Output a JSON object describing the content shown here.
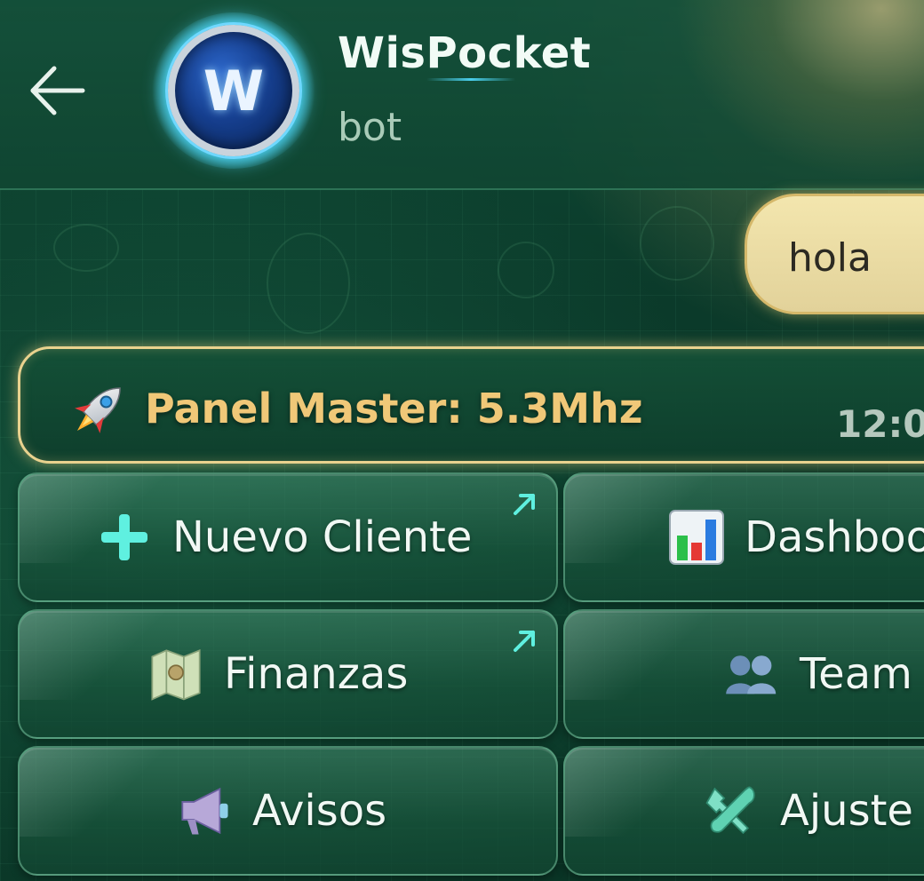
{
  "header": {
    "back_label": "Back",
    "avatar_letter": "W",
    "title": "WisPocket",
    "subtitle": "bot"
  },
  "messages": {
    "user": {
      "text": "hola"
    },
    "bot": {
      "icon": "rocket-icon",
      "text": "Panel Master: 5.3Mhz",
      "time": "12:0"
    }
  },
  "keyboard": {
    "buttons": [
      {
        "label": "Nuevo Cliente",
        "icon": "plus-icon",
        "external": true
      },
      {
        "label": "Dashboo",
        "icon": "bar-chart-icon",
        "external": false
      },
      {
        "label": "Finanzas",
        "icon": "map-icon",
        "external": true
      },
      {
        "label": "Team",
        "icon": "people-icon",
        "external": false
      },
      {
        "label": "Avisos",
        "icon": "megaphone-icon",
        "external": false
      },
      {
        "label": "Ajuste",
        "icon": "tools-icon",
        "external": false
      }
    ]
  },
  "colors": {
    "accent_gold": "#e9d28e",
    "accent_cyan": "#5ff0e0",
    "background": "#0b3a2a",
    "user_bubble": "#f3e6ae"
  }
}
